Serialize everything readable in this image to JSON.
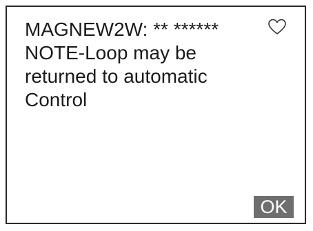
{
  "dialog": {
    "message_lines": [
      "MAGNEW2W: ** ******",
      "NOTE-Loop may be",
      "returned to automatic",
      "Control"
    ],
    "ok_label": "OK",
    "favorite_icon": "heart-outline-icon"
  }
}
